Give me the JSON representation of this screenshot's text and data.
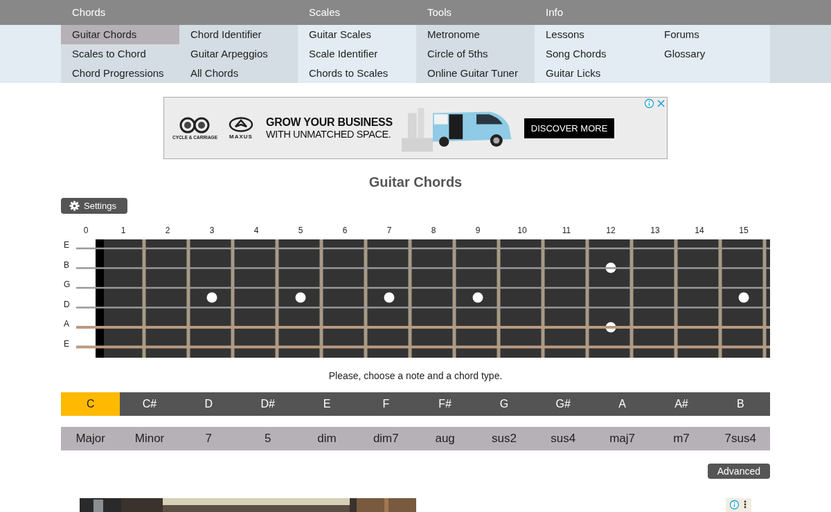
{
  "nav": [
    {
      "title": "Chords",
      "columns": [
        [
          {
            "label": "Guitar Chords",
            "selected": true
          },
          {
            "label": "Scales to Chord",
            "selected": false
          },
          {
            "label": "Chord Progressions",
            "selected": false
          }
        ],
        [
          {
            "label": "Chord Identifier",
            "selected": false
          },
          {
            "label": "Guitar Arpeggios",
            "selected": false
          },
          {
            "label": "All Chords",
            "selected": false
          }
        ]
      ]
    },
    {
      "title": "Scales",
      "columns": [
        [
          {
            "label": "Guitar Scales",
            "selected": false
          },
          {
            "label": "Scale Identifier",
            "selected": false
          },
          {
            "label": "Chords to Scales",
            "selected": false
          }
        ]
      ]
    },
    {
      "title": "Tools",
      "columns": [
        [
          {
            "label": "Metronome",
            "selected": false
          },
          {
            "label": "Circle of 5ths",
            "selected": false
          },
          {
            "label": "Online Guitar Tuner",
            "selected": false
          }
        ]
      ]
    },
    {
      "title": "Info",
      "columns": [
        [
          {
            "label": "Lessons",
            "selected": false
          },
          {
            "label": "Song Chords",
            "selected": false
          },
          {
            "label": "Guitar Licks",
            "selected": false
          }
        ],
        [
          {
            "label": "Forums",
            "selected": false
          },
          {
            "label": "Glossary",
            "selected": false
          }
        ]
      ]
    }
  ],
  "ad": {
    "brand_1": "CYCLE & CARRIAGE",
    "brand_2": "MAXUS",
    "headline": "GROW YOUR BUSINESS",
    "subline": "WITH UNMATCHED SPACE.",
    "cta": "DISCOVER MORE"
  },
  "title": "Guitar Chords",
  "settings_button": "Settings",
  "fretboard": {
    "frets": [
      {
        "label": "0",
        "kind": "plain"
      },
      {
        "label": "1",
        "kind": "plain"
      },
      {
        "label": "2",
        "kind": "plain"
      },
      {
        "label": "3",
        "kind": "dot"
      },
      {
        "label": "4",
        "kind": "plain"
      },
      {
        "label": "5",
        "kind": "dot"
      },
      {
        "label": "6",
        "kind": "plain"
      },
      {
        "label": "7",
        "kind": "dot"
      },
      {
        "label": "8",
        "kind": "plain"
      },
      {
        "label": "9",
        "kind": "dot"
      },
      {
        "label": "10",
        "kind": "plain"
      },
      {
        "label": "11",
        "kind": "plain"
      },
      {
        "label": "12",
        "kind": "double"
      },
      {
        "label": "13",
        "kind": "plain"
      },
      {
        "label": "14",
        "kind": "plain"
      },
      {
        "label": "15",
        "kind": "dot"
      }
    ],
    "strings": [
      {
        "label": "E",
        "kind": "plain"
      },
      {
        "label": "B",
        "kind": "plain"
      },
      {
        "label": "G",
        "kind": "plain"
      },
      {
        "label": "D",
        "kind": "plain"
      },
      {
        "label": "A",
        "kind": "wound"
      },
      {
        "label": "E",
        "kind": "wound"
      }
    ]
  },
  "hint": "Please, choose a note and a chord type.",
  "notes": [
    {
      "label": "C",
      "selected": true
    },
    {
      "label": "C#",
      "selected": false
    },
    {
      "label": "D",
      "selected": false
    },
    {
      "label": "D#",
      "selected": false
    },
    {
      "label": "E",
      "selected": false
    },
    {
      "label": "F",
      "selected": false
    },
    {
      "label": "F#",
      "selected": false
    },
    {
      "label": "G",
      "selected": false
    },
    {
      "label": "G#",
      "selected": false
    },
    {
      "label": "A",
      "selected": false
    },
    {
      "label": "A#",
      "selected": false
    },
    {
      "label": "B",
      "selected": false
    }
  ],
  "chord_types": [
    {
      "label": "Major",
      "selected": false
    },
    {
      "label": "Minor",
      "selected": false
    },
    {
      "label": "7",
      "selected": false
    },
    {
      "label": "5",
      "selected": false
    },
    {
      "label": "dim",
      "selected": false
    },
    {
      "label": "dim7",
      "selected": false
    },
    {
      "label": "aug",
      "selected": false
    },
    {
      "label": "sus2",
      "selected": false
    },
    {
      "label": "sus4",
      "selected": false
    },
    {
      "label": "maj7",
      "selected": false
    },
    {
      "label": "m7",
      "selected": false
    },
    {
      "label": "7sus4",
      "selected": false
    }
  ],
  "advanced_button": "Advanced"
}
